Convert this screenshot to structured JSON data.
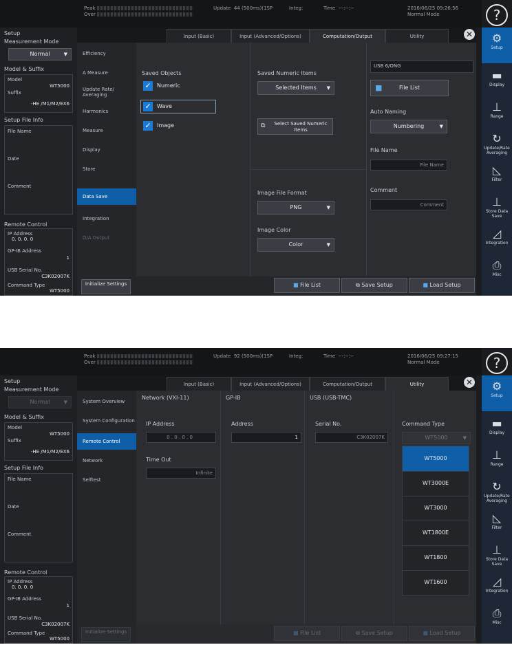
{
  "status": {
    "peak_label": "Peak",
    "over_label": "Over",
    "update_label": "Update",
    "integ_label": "Integ:",
    "time_label": "Time",
    "time_value": "---:--:--",
    "mode": "Normal Mode",
    "screen1": {
      "update_value": "44 (500ms)(1SP",
      "datetime": "2016/06/25 09:26:56"
    },
    "screen2": {
      "update_value": "92 (500ms)(1SP",
      "datetime": "2016/06/25 09:27:15"
    }
  },
  "left": {
    "setup_title": "Setup",
    "measurement_mode_label": "Measurement Mode",
    "measurement_mode_value": "Normal",
    "model_suffix_label": "Model & Suffix",
    "model_label": "Model",
    "model_value": "WT5000",
    "suffix_label": "Suffix",
    "suffix_value": "-HE /M1/M2/EX6",
    "setup_file_info": "Setup File Info",
    "file_name_label": "File Name",
    "date_label": "Date",
    "comment_label": "Comment",
    "remote_control": "Remote Control",
    "ip_address_label": "IP Address",
    "ip_address_value": "0. 0. 0. 0",
    "gpib_address_label": "GP-IB Address",
    "gpib_address_value": "1",
    "usb_serial_label": "USB Serial No.",
    "usb_serial_value": "C3K02007K",
    "command_type_label": "Command Type",
    "command_type_value": "WT5000"
  },
  "tabs": {
    "t1": "Input (Basic)",
    "t2": "Input (Advanced/Options)",
    "t3": "Computation/Output",
    "t4": "Utility"
  },
  "screen1": {
    "menu": [
      "Efficiency",
      "Δ Measure",
      "Update Rate/ Averaging",
      "Harmonics",
      "Measure",
      "Display",
      "Store",
      "Data Save",
      "Integration",
      "D/A Output"
    ],
    "init_btn": "Initialize Settings",
    "saved_objects_label": "Saved Objects",
    "chk_numeric": "Numeric",
    "chk_wave": "Wave",
    "chk_image": "Image",
    "saved_numeric_items_label": "Saved Numeric Items",
    "saved_numeric_items_value": "Selected Items",
    "select_saved_btn": "Select Saved Numeric Items",
    "image_format_label": "Image File Format",
    "image_format_value": "PNG",
    "image_color_label": "Image Color",
    "image_color_value": "Color",
    "path_value": "USB 6/ONG",
    "file_list_btn": "File List",
    "auto_naming_label": "Auto Naming",
    "auto_naming_value": "Numbering",
    "file_name_label": "File Name",
    "file_name_value": "File Name",
    "comment_label": "Comment",
    "comment_value": "Comment",
    "bottom_file_list": "File List",
    "bottom_save_setup": "Save Setup",
    "bottom_load_setup": "Load Setup"
  },
  "screen2": {
    "menu": [
      "System Overview",
      "System Configuration",
      "Remote Control",
      "Network",
      "Selftest"
    ],
    "init_btn": "Initialize Settings",
    "network_label": "Network (VXI-11)",
    "ip_label": "IP Address",
    "ip_value": "0 . 0 . 0 . 0",
    "timeout_label": "Time Out",
    "timeout_value": "Infinite",
    "gpib_label": "GP-IB",
    "address_label": "Address",
    "address_value": "1",
    "usb_label": "USB (USB-TMC)",
    "serial_label": "Serial No.",
    "serial_value": "C3K02007K",
    "command_type_label": "Command Type",
    "command_type_value": "WT5000",
    "options": [
      "WT5000",
      "WT3000E",
      "WT3000",
      "WT1800E",
      "WT1800",
      "WT1600"
    ]
  },
  "rightbar": [
    "Setup",
    "Display",
    "Range",
    "Update/Rate Averaging",
    "Filter",
    "Store Data Save",
    "Integration",
    "Misc"
  ]
}
